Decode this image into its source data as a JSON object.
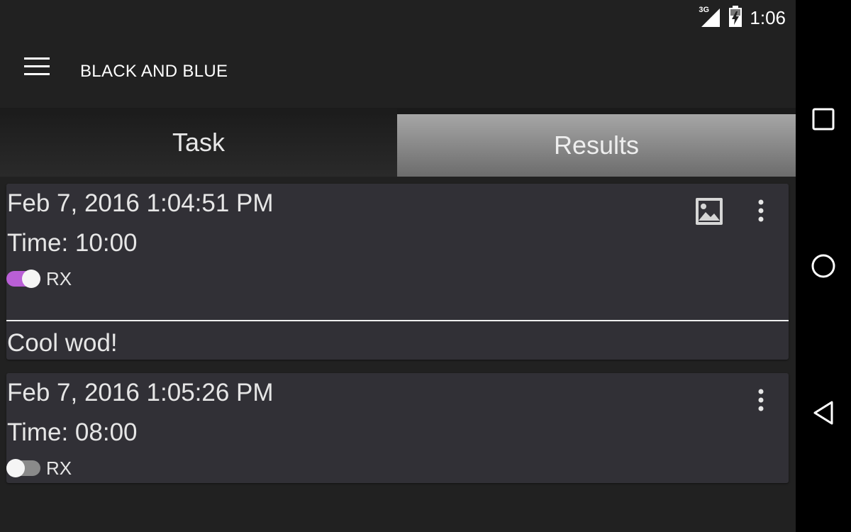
{
  "status_bar": {
    "network": "3G",
    "time": "1:06",
    "icons": [
      "signal-icon",
      "battery-charging-icon"
    ]
  },
  "app_bar": {
    "title": "BLACK AND BLUE",
    "menu_icon": "hamburger-menu-icon"
  },
  "tabs": [
    {
      "label": "Task",
      "selected": false
    },
    {
      "label": "Results",
      "selected": true
    }
  ],
  "results": [
    {
      "date": "Feb 7, 2016 1:04:51 PM",
      "time": "Time: 10:00",
      "rx_label": "RX",
      "rx_on": true,
      "has_image": true,
      "comment": "Cool wod!"
    },
    {
      "date": "Feb 7, 2016 1:05:26 PM",
      "time": "Time: 08:00",
      "rx_label": "RX",
      "rx_on": false,
      "has_image": false
    }
  ],
  "colors": {
    "accent": "#b95fd6",
    "switch_off_track": "#8a8a8a",
    "card_bg": "#313036",
    "screen_bg": "#212121"
  },
  "nav_bar": {
    "icons": [
      "recents-icon",
      "home-icon",
      "back-icon"
    ]
  }
}
